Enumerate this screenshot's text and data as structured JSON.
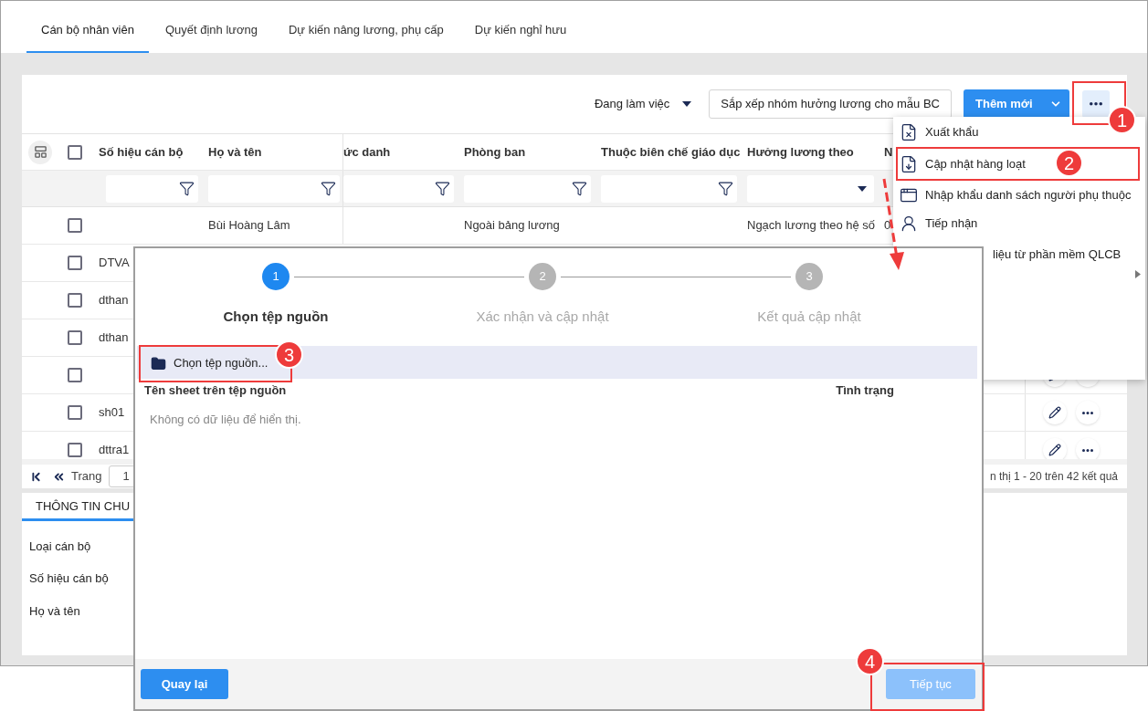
{
  "tabs": [
    {
      "label": "Cán bộ nhân viên",
      "selected": true
    },
    {
      "label": "Quyết định lương",
      "selected": false
    },
    {
      "label": "Dự kiến nâng lương, phụ cấp",
      "selected": false
    },
    {
      "label": "Dự kiến nghỉ hưu",
      "selected": false
    }
  ],
  "toolbar": {
    "status_filter": "Đang làm việc",
    "sort_button": "Sắp xếp nhóm hưởng lương cho mẫu BC",
    "add_button": "Thêm mới"
  },
  "table": {
    "all_checked": false,
    "columns": [
      {
        "label": "Số hiệu cán bộ"
      },
      {
        "label": "Họ và tên"
      },
      {
        "label": "ức danh"
      },
      {
        "label": "Phòng ban"
      },
      {
        "label": "Thuộc biên chế giáo dục"
      },
      {
        "label": "Hưởng lương theo"
      },
      {
        "label": "N"
      }
    ],
    "filters": [
      {
        "kind": "text"
      },
      {
        "kind": "text"
      },
      {
        "kind": "text"
      },
      {
        "kind": "text"
      },
      {
        "kind": "text"
      },
      {
        "kind": "select"
      }
    ],
    "rows": [
      {
        "checked": false,
        "cells": [
          "",
          "Bùi Hoàng Lâm",
          "",
          "Ngoài bảng lương",
          "",
          "Ngạch lương theo hệ số",
          "0"
        ]
      },
      {
        "checked": false,
        "cells": [
          "DTVA"
        ]
      },
      {
        "checked": false,
        "cells": [
          "dthan"
        ]
      },
      {
        "checked": false,
        "cells": [
          "dthan"
        ]
      },
      {
        "checked": false,
        "cells": [
          ""
        ]
      },
      {
        "checked": false,
        "cells": [
          "sh01"
        ]
      },
      {
        "checked": false,
        "cells": [
          "dttra1"
        ]
      }
    ]
  },
  "pagination": {
    "page_label": "Trang",
    "page": "1",
    "summary": "n thị 1 - 20 trên 42 kết quả"
  },
  "info_panel": {
    "tab": "THÔNG TIN CHU",
    "fields": [
      "Loại cán bộ",
      "Số hiệu cán bộ",
      "Họ và tên"
    ]
  },
  "menu": {
    "items": [
      {
        "kind": "export",
        "label": "Xuất khẩu"
      },
      {
        "kind": "update",
        "label": "Cập nhật hàng loạt"
      },
      {
        "kind": "import",
        "label": "Nhập khẩu danh sách người phụ thuộc"
      },
      {
        "kind": "receive",
        "label": "Tiếp nhận"
      },
      {
        "kind": "covered",
        "label": "liệu từ phần mềm QLCB"
      }
    ]
  },
  "dialog": {
    "steps": [
      {
        "number": "1",
        "label": "Chọn tệp nguồn",
        "selected": true
      },
      {
        "number": "2",
        "label": "Xác nhận và cập nhật",
        "selected": false
      },
      {
        "number": "3",
        "label": "Kết quả cập nhật",
        "selected": false
      }
    ],
    "choose_file_button": "Chọn tệp nguồn...",
    "columns": [
      "Tên sheet trên tệp nguồn",
      "Tình trạng"
    ],
    "empty_message": "Không có dữ liệu để hiển thị.",
    "back_button": "Quay lại",
    "next_button": {
      "label": "Tiếp tục",
      "disabled": true
    }
  },
  "annotations": [
    {
      "number": "1"
    },
    {
      "number": "2"
    },
    {
      "number": "3"
    },
    {
      "number": "4"
    }
  ]
}
